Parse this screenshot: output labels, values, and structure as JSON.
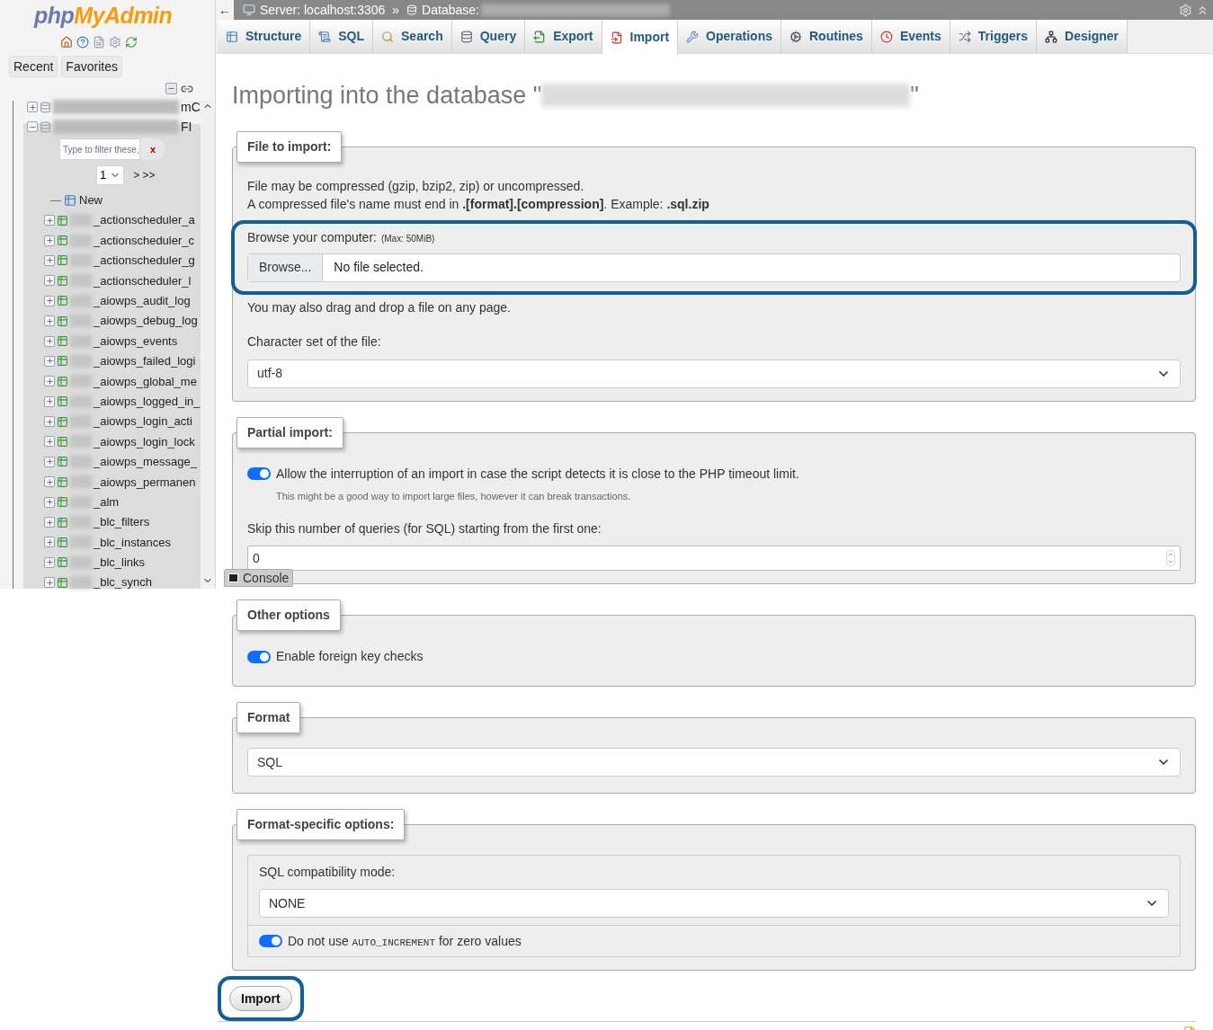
{
  "sidebar": {
    "logo": {
      "part1": "php",
      "part2": "MyAdmin"
    },
    "buttons": [
      {
        "label": "Recent"
      },
      {
        "label": "Favorites"
      }
    ],
    "databases": [
      {
        "suffix": "mC",
        "expanded": false
      },
      {
        "suffix": "FI",
        "expanded": true
      }
    ],
    "filter": {
      "placeholder": "Type to filter these,",
      "clear": "x"
    },
    "page_select": "1",
    "page_nav": "> >>",
    "new_label": "New",
    "tables": [
      {
        "name": "_actionscheduler_a"
      },
      {
        "name": "_actionscheduler_c"
      },
      {
        "name": "_actionscheduler_g"
      },
      {
        "name": "_actionscheduler_l"
      },
      {
        "name": "_aiowps_audit_log"
      },
      {
        "name": "_aiowps_debug_log"
      },
      {
        "name": "_aiowps_events"
      },
      {
        "name": "_aiowps_failed_logi"
      },
      {
        "name": "_aiowps_global_me"
      },
      {
        "name": "_aiowps_logged_in_"
      },
      {
        "name": "_aiowps_login_acti"
      },
      {
        "name": "_aiowps_login_lock"
      },
      {
        "name": "_aiowps_message_"
      },
      {
        "name": "_aiowps_permanen"
      },
      {
        "name": "_alm"
      },
      {
        "name": "_blc_filters"
      },
      {
        "name": "_blc_instances"
      },
      {
        "name": "_blc_links"
      },
      {
        "name": "_blc_synch"
      }
    ]
  },
  "breadcrumb": {
    "back": "←",
    "server": "Server: localhost:3306",
    "separator": "»",
    "database": "Database:"
  },
  "tabs": [
    {
      "label": "Structure",
      "kind": "structure",
      "selected": false
    },
    {
      "label": "SQL",
      "kind": "sql",
      "selected": false
    },
    {
      "label": "Search",
      "kind": "search",
      "selected": false
    },
    {
      "label": "Query",
      "kind": "query",
      "selected": false
    },
    {
      "label": "Export",
      "kind": "export",
      "selected": false
    },
    {
      "label": "Import",
      "kind": "import",
      "selected": true
    },
    {
      "label": "Operations",
      "kind": "operations",
      "selected": false
    },
    {
      "label": "Routines",
      "kind": "routines",
      "selected": false
    },
    {
      "label": "Events",
      "kind": "events",
      "selected": false
    },
    {
      "label": "Triggers",
      "kind": "triggers",
      "selected": false
    },
    {
      "label": "Designer",
      "kind": "designer",
      "selected": false
    }
  ],
  "heading": {
    "text": "Importing into the database \"",
    "closing": "\""
  },
  "file_to_import": {
    "legend": "File to import:",
    "notes": [
      "File may be compressed (gzip, bzip2, zip) or uncompressed.",
      "A compressed file's name must end in **.[format].[compression]**. Example: **.sql.zip**"
    ],
    "browse_label": "Browse your computer:",
    "max_size": "(Max: 50MiB)",
    "browse_button": "Browse...",
    "file_status": "No file selected.",
    "highlighted": true,
    "drag_note": "You may also drag and drop a file on any page.",
    "charset_label": "Character set of the file:",
    "charset_value": "utf-8"
  },
  "partial_import": {
    "legend": "Partial import:",
    "allow_interrupt": {
      "label": "Allow the interruption of an import in case the script detects it is close to the PHP timeout limit.",
      "on": true
    },
    "hint": "This might be a good way to import large files, however it can break transactions.",
    "skip_label": "Skip this number of queries (for SQL) starting from the first one:",
    "skip_value": "0"
  },
  "console": {
    "label": "Console"
  },
  "other_options": {
    "legend": "Other options",
    "foreign_keys": {
      "label": "Enable foreign key checks",
      "on": true
    }
  },
  "format": {
    "legend": "Format",
    "value": "SQL"
  },
  "format_specific": {
    "legend": "Format-specific options:",
    "compat_label": "SQL compatibility mode:",
    "compat_value": "NONE",
    "auto_increment": {
      "before": "Do not use",
      "code": "AUTO_INCREMENT",
      "after": "for zero values",
      "on": true
    }
  },
  "import_button": {
    "label": "Import",
    "highlighted": true
  }
}
